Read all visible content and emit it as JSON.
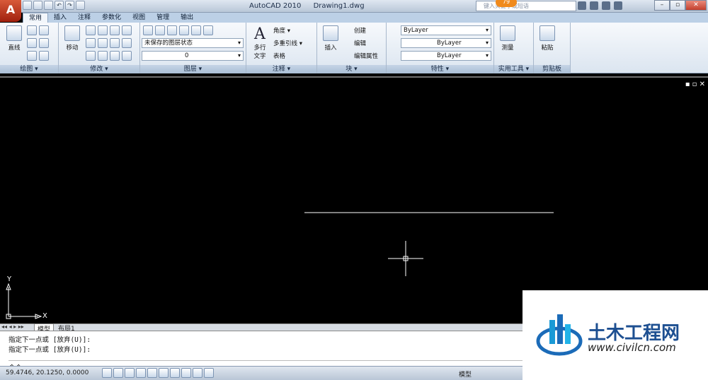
{
  "app": {
    "logo": "A",
    "title": "AutoCAD 2010",
    "filename": "Drawing1.dwg",
    "search_placeholder": "键入关键字或短语",
    "badge": "79"
  },
  "tabs": [
    "常用",
    "插入",
    "注释",
    "参数化",
    "视图",
    "管理",
    "输出"
  ],
  "panels": {
    "draw": {
      "title": "绘图 ▾",
      "line": "直线"
    },
    "modify": {
      "title": "修改 ▾",
      "move": "移动"
    },
    "layers": {
      "title": "图层 ▾",
      "state": "未保存的图层状态",
      "layer": "0"
    },
    "annotation": {
      "title": "注释 ▾",
      "mtext": "多行\n文字",
      "angle": "角度",
      "mleader": "多重引线",
      "table": "表格"
    },
    "block": {
      "title": "块 ▾",
      "insert": "插入",
      "create": "创建",
      "edit": "编辑",
      "attr": "编辑属性"
    },
    "properties": {
      "title": "特性 ▾",
      "color": "ByLayer",
      "linetype": "ByLayer",
      "lineweight": "ByLayer"
    },
    "utilities": {
      "title": "实用工具 ▾",
      "measure": "测量"
    },
    "clipboard": {
      "title": "剪贴板",
      "paste": "粘贴"
    }
  },
  "ucs": {
    "x": "X",
    "y": "Y"
  },
  "layout_tabs": [
    "模型",
    "布局1"
  ],
  "command": {
    "line1": "指定下一点或 [放弃(U)]:",
    "line2": "指定下一点或 [放弃(U)]:",
    "prompt": "命令:"
  },
  "status": {
    "coords": "59.4746,  20.1250, 0.0000",
    "model": "模型"
  },
  "watermark": {
    "brand": "土木工程网",
    "url": "www.civilcn.com"
  }
}
